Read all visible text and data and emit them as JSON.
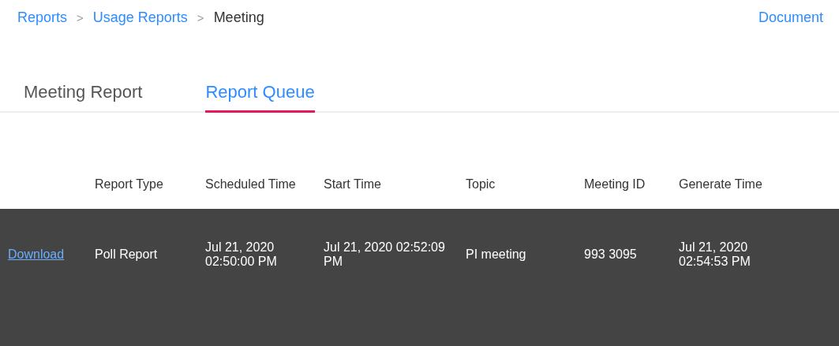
{
  "breadcrumb": [
    {
      "label": "Reports",
      "link": true
    },
    {
      "label": "Usage Reports",
      "link": true
    },
    {
      "label": "Meeting",
      "link": false
    }
  ],
  "separator": ">",
  "document_link": "Document",
  "tabs": [
    {
      "label": "Meeting Report",
      "selected": false
    },
    {
      "label": "Report Queue",
      "selected": true
    }
  ],
  "table": {
    "columns": [
      "Report Type",
      "Scheduled Time",
      "Start Time",
      "Topic",
      "Meeting ID",
      "Generate Time"
    ],
    "rows": [
      {
        "action": "Download",
        "cells": [
          "Poll Report",
          "Jul 21, 2020 02:50:00 PM",
          "Jul 21, 2020 02:52:09 PM",
          "PI meeting",
          "993 3095",
          "Jul 21, 2020 02:54:53 PM"
        ]
      }
    ]
  }
}
